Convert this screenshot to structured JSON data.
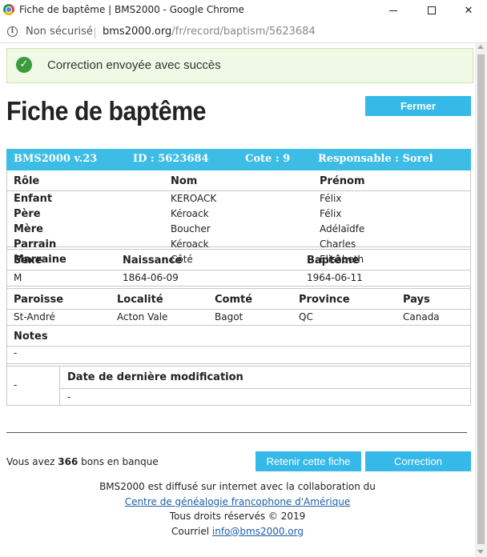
{
  "window": {
    "title": "Fiche de baptême | BMS2000 - Google Chrome",
    "insecure_label": "Non sécurisé",
    "url_host": "bms2000.org",
    "url_path": "/fr/record/baptism/5623684"
  },
  "alert": {
    "message": "Correction envoyée avec succès"
  },
  "page": {
    "title": "Fiche de baptême",
    "close_label": "Fermer"
  },
  "record": {
    "header": {
      "version": "BMS2000 v.23",
      "id": "ID : 5623684",
      "cote": "Cote : 9",
      "responsable": "Responsable : Sorel"
    },
    "persons": {
      "columns": [
        "Rôle",
        "Nom",
        "Prénom"
      ],
      "rows": [
        {
          "role": "Enfant",
          "nom": "KEROACK",
          "prenom": "Félix"
        },
        {
          "role": "Père",
          "nom": "Kéroack",
          "prenom": "Félix"
        },
        {
          "role": "Mère",
          "nom": "Boucher",
          "prenom": "Adélaïdfe"
        },
        {
          "role": "Parrain",
          "nom": "Kéroack",
          "prenom": "Charles"
        },
        {
          "role": "Marraine",
          "nom": "Côté",
          "prenom": "Elisabeth"
        }
      ]
    },
    "event": {
      "columns": [
        "Sexe",
        "Naissance",
        "Baptême"
      ],
      "values": [
        "M",
        "1864-06-09",
        "1964-06-11"
      ]
    },
    "place": {
      "columns": [
        "Paroisse",
        "Localité",
        "Comté",
        "Province",
        "Pays"
      ],
      "values": [
        "St-André",
        "Acton Vale",
        "Bagot",
        "QC",
        "Canada"
      ]
    },
    "notes": {
      "label": "Notes",
      "value": "-"
    },
    "modification": {
      "left_value": "-",
      "label": "Date de dernière modification",
      "value": "-"
    }
  },
  "credits": {
    "prefix": "Vous avez ",
    "count": "366",
    "suffix": " bons en banque"
  },
  "actions": {
    "keep_label": "Retenir cette fiche",
    "correction_label": "Correction"
  },
  "footer": {
    "line1": "BMS2000 est diffusé sur internet avec la collaboration du",
    "link1": "Centre de généalogie francophone d'Amérique",
    "line3": "Tous droits réservés © 2019",
    "line4_prefix": "Courriel ",
    "email": "info@bms2000.org"
  }
}
